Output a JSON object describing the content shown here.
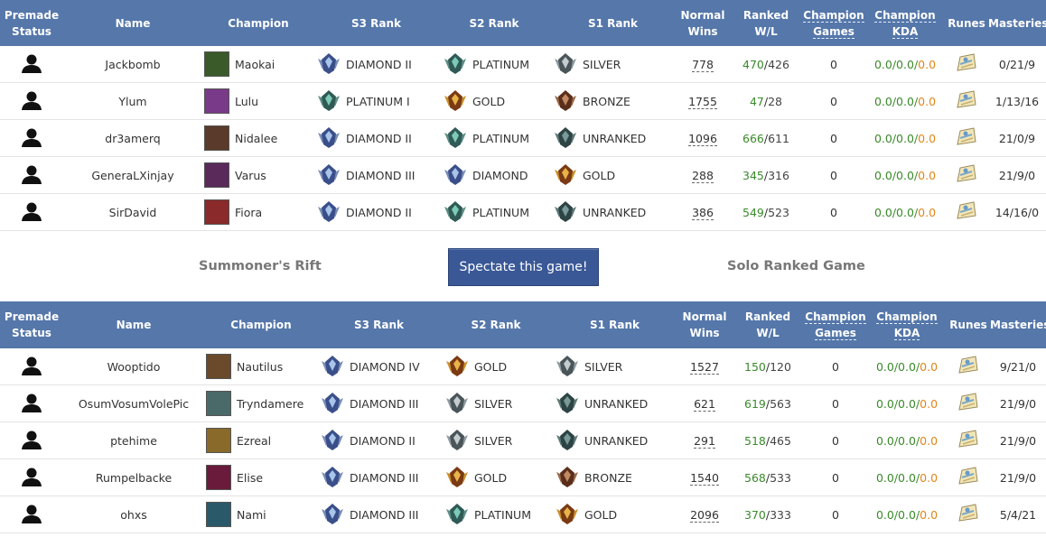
{
  "headers": {
    "premade": [
      "Premade",
      "Status"
    ],
    "name": "Name",
    "champion": "Champion",
    "s3": "S3 Rank",
    "s2": "S2 Rank",
    "s1": "S1 Rank",
    "normal": [
      "Normal",
      "Wins"
    ],
    "ranked": [
      "Ranked",
      "W/L"
    ],
    "champ_games": [
      "Champion",
      "Games"
    ],
    "champ_kda": [
      "Champion",
      "KDA"
    ],
    "runes": "Runes",
    "masteries": "Masteries"
  },
  "middle": {
    "map": "Summoner's Rift",
    "spectate": "Spectate this game!",
    "queue": "Solo Ranked Game"
  },
  "colors": {
    "header_bg": "#5577aa",
    "button_bg": "#3a5896",
    "win_green": "#3a8a2a",
    "kda_orange": "#e0861a"
  },
  "team1": [
    {
      "name": "Jackbomb",
      "champion": "Maokai",
      "champ_color": "#3a5a2a",
      "s3": "DIAMOND II",
      "s3_tier": "diamond",
      "s2": "PLATINUM",
      "s2_tier": "platinum",
      "s1": "SILVER",
      "s1_tier": "silver",
      "normal": "778",
      "wins": "470",
      "losses": "426",
      "games": "0",
      "kda_k": "0.0",
      "kda_d": "0.0",
      "kda_a": "0.0",
      "masteries": "0/21/9"
    },
    {
      "name": "Ylum",
      "champion": "Lulu",
      "champ_color": "#7a3a8a",
      "s3": "PLATINUM I",
      "s3_tier": "platinum",
      "s2": "GOLD",
      "s2_tier": "gold",
      "s1": "BRONZE",
      "s1_tier": "bronze",
      "normal": "1755",
      "wins": "47",
      "losses": "28",
      "games": "0",
      "kda_k": "0.0",
      "kda_d": "0.0",
      "kda_a": "0.0",
      "masteries": "1/13/16"
    },
    {
      "name": "dr3amerq",
      "champion": "Nidalee",
      "champ_color": "#5a3a2a",
      "s3": "DIAMOND II",
      "s3_tier": "diamond",
      "s2": "PLATINUM",
      "s2_tier": "platinum",
      "s1": "UNRANKED",
      "s1_tier": "unranked",
      "normal": "1096",
      "wins": "666",
      "losses": "611",
      "games": "0",
      "kda_k": "0.0",
      "kda_d": "0.0",
      "kda_a": "0.0",
      "masteries": "21/0/9"
    },
    {
      "name": "GeneraLXinjay",
      "champion": "Varus",
      "champ_color": "#5a2a5a",
      "s3": "DIAMOND III",
      "s3_tier": "diamond",
      "s2": "DIAMOND",
      "s2_tier": "diamond",
      "s1": "GOLD",
      "s1_tier": "gold",
      "normal": "288",
      "wins": "345",
      "losses": "316",
      "games": "0",
      "kda_k": "0.0",
      "kda_d": "0.0",
      "kda_a": "0.0",
      "masteries": "21/9/0"
    },
    {
      "name": "SirDavid",
      "champion": "Fiora",
      "champ_color": "#8a2a2a",
      "s3": "DIAMOND II",
      "s3_tier": "diamond",
      "s2": "PLATINUM",
      "s2_tier": "platinum",
      "s1": "UNRANKED",
      "s1_tier": "unranked",
      "normal": "386",
      "wins": "549",
      "losses": "523",
      "games": "0",
      "kda_k": "0.0",
      "kda_d": "0.0",
      "kda_a": "0.0",
      "masteries": "14/16/0"
    }
  ],
  "team2": [
    {
      "name": "Wooptido",
      "champion": "Nautilus",
      "champ_color": "#6a4a2a",
      "s3": "DIAMOND IV",
      "s3_tier": "diamond",
      "s2": "GOLD",
      "s2_tier": "gold",
      "s1": "SILVER",
      "s1_tier": "silver",
      "normal": "1527",
      "wins": "150",
      "losses": "120",
      "games": "0",
      "kda_k": "0.0",
      "kda_d": "0.0",
      "kda_a": "0.0",
      "masteries": "9/21/0"
    },
    {
      "name": "OsumVosumVolePic",
      "champion": "Tryndamere",
      "champ_color": "#4a6a6a",
      "s3": "DIAMOND III",
      "s3_tier": "diamond",
      "s2": "SILVER",
      "s2_tier": "silver",
      "s1": "UNRANKED",
      "s1_tier": "unranked",
      "normal": "621",
      "wins": "619",
      "losses": "563",
      "games": "0",
      "kda_k": "0.0",
      "kda_d": "0.0",
      "kda_a": "0.0",
      "masteries": "21/9/0"
    },
    {
      "name": "ptehime",
      "champion": "Ezreal",
      "champ_color": "#8a6a2a",
      "s3": "DIAMOND II",
      "s3_tier": "diamond",
      "s2": "SILVER",
      "s2_tier": "silver",
      "s1": "UNRANKED",
      "s1_tier": "unranked",
      "normal": "291",
      "wins": "518",
      "losses": "465",
      "games": "0",
      "kda_k": "0.0",
      "kda_d": "0.0",
      "kda_a": "0.0",
      "masteries": "21/9/0"
    },
    {
      "name": "Rumpelbacke",
      "champion": "Elise",
      "champ_color": "#6a1a3a",
      "s3": "DIAMOND III",
      "s3_tier": "diamond",
      "s2": "GOLD",
      "s2_tier": "gold",
      "s1": "BRONZE",
      "s1_tier": "bronze",
      "normal": "1540",
      "wins": "568",
      "losses": "533",
      "games": "0",
      "kda_k": "0.0",
      "kda_d": "0.0",
      "kda_a": "0.0",
      "masteries": "21/9/0"
    },
    {
      "name": "ohxs",
      "champion": "Nami",
      "champ_color": "#2a5a6a",
      "s3": "DIAMOND III",
      "s3_tier": "diamond",
      "s2": "PLATINUM",
      "s2_tier": "platinum",
      "s1": "GOLD",
      "s1_tier": "gold",
      "normal": "2096",
      "wins": "370",
      "losses": "333",
      "games": "0",
      "kda_k": "0.0",
      "kda_d": "0.0",
      "kda_a": "0.0",
      "masteries": "5/4/21"
    }
  ]
}
